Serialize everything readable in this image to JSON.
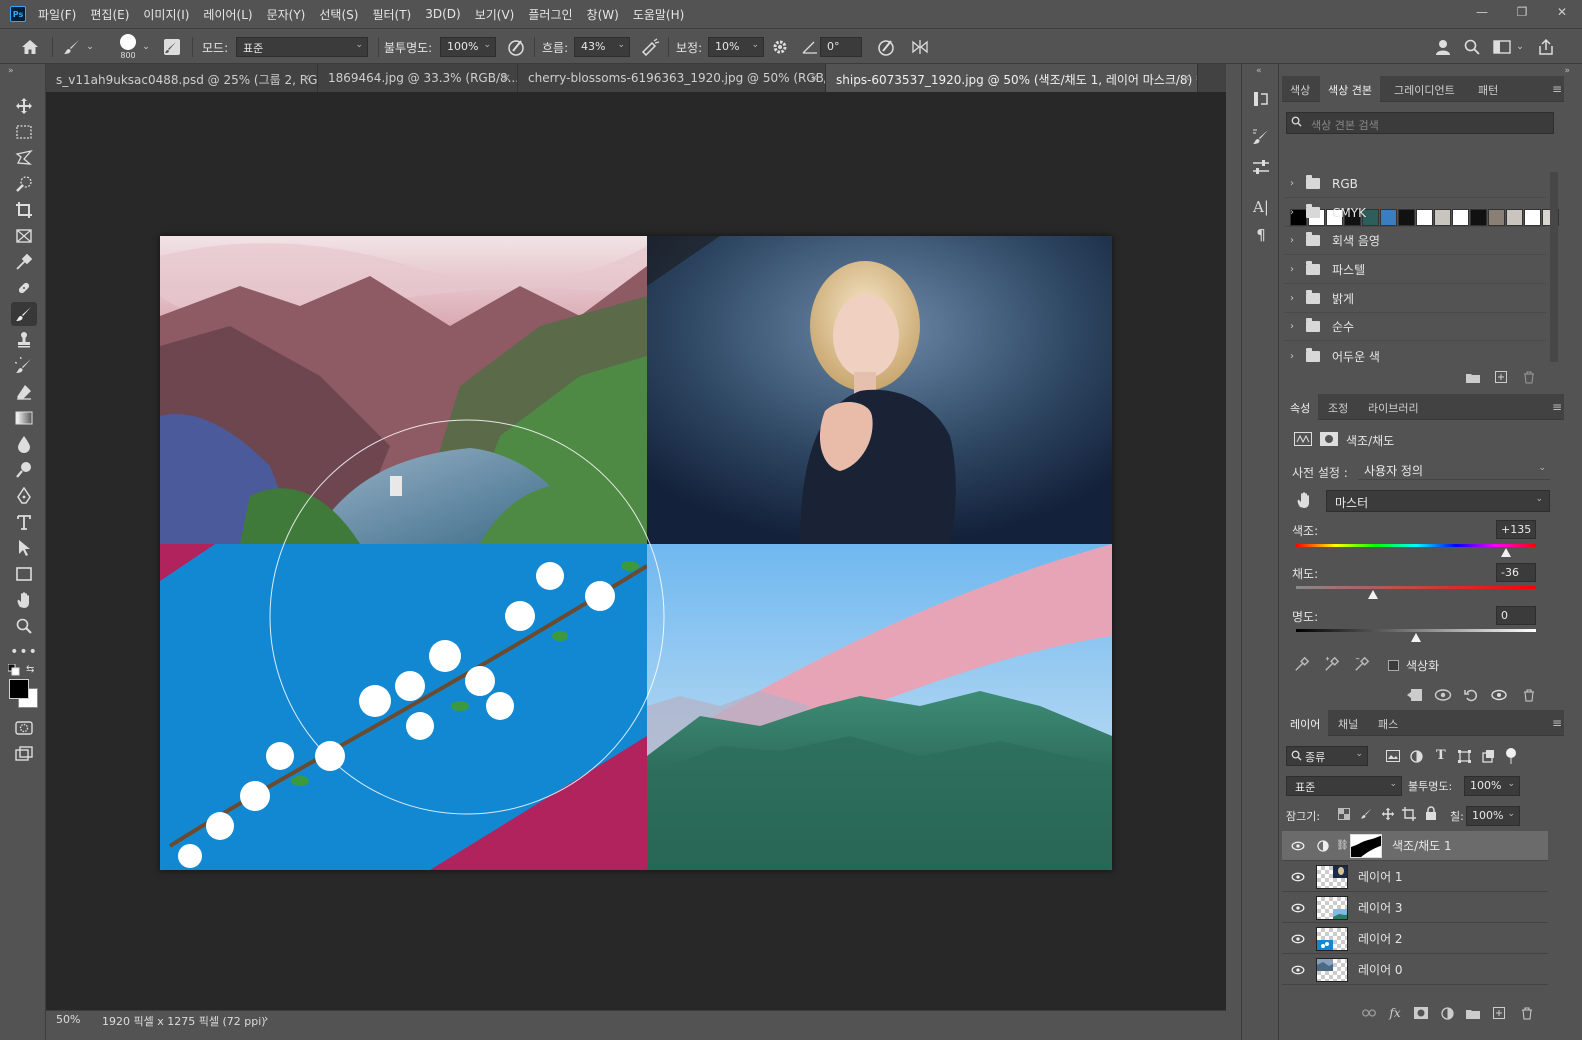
{
  "app": {
    "logo": "Ps"
  },
  "menu": [
    "파일(F)",
    "편집(E)",
    "이미지(I)",
    "레이어(L)",
    "문자(Y)",
    "선택(S)",
    "필터(T)",
    "3D(D)",
    "보기(V)",
    "플러그인",
    "창(W)",
    "도움말(H)"
  ],
  "window_controls": {
    "minimize": "—",
    "restore": "❐",
    "close": "✕"
  },
  "options": {
    "brush_size": "800",
    "mode_label": "모드:",
    "mode_value": "표준",
    "opacity_label": "불투명도:",
    "opacity_value": "100%",
    "flow_label": "흐름:",
    "flow_value": "43%",
    "smoothing_label": "보정:",
    "smoothing_value": "10%",
    "angle_value": "0°"
  },
  "tabs": [
    {
      "label": "s_v11ah9uksac0488.psd @ 25% (그룹 2, RG...",
      "close": "×"
    },
    {
      "label": "1869464.jpg @ 33.3% (RGB/8...",
      "close": "×"
    },
    {
      "label": "cherry-blossoms-6196363_1920.jpg @ 50% (RGB/...",
      "close": "×"
    },
    {
      "label": "ships-6073537_1920.jpg @ 50% (색조/채도 1, 레이어 마스크/8) *",
      "close": "×"
    }
  ],
  "status": {
    "zoom": "50%",
    "doc_size": "1920 픽셀 x 1275 픽셀 (72 ppi)",
    "arrow": "›"
  },
  "swatches_panel": {
    "tabs": [
      "색상",
      "색상 견본",
      "그레이디언트",
      "패턴"
    ],
    "search_placeholder": "색상 견본 검색",
    "colors": [
      "#000000",
      "#ffffff",
      "#ffffff",
      "#111111",
      "#2c5f5c",
      "#3a7dc0",
      "#111111",
      "#ffffff",
      "#c9c4bd",
      "#ffffff",
      "#111111",
      "#8a7f74",
      "#c9c4bd",
      "#ffffff",
      "#d9d5d0"
    ],
    "groups": [
      "RGB",
      "CMYK",
      "회색 음영",
      "파스텔",
      "밝게",
      "순수",
      "어두운 색"
    ]
  },
  "properties_panel": {
    "tabs": [
      "속성",
      "조정",
      "라이브러리"
    ],
    "title": "색조/채도",
    "preset_label": "사전 설정 :",
    "preset_value": "사용자 정의",
    "channel_value": "마스터",
    "hue_label": "색조:",
    "hue_value": "+135",
    "hue": 135,
    "saturation_label": "채도:",
    "saturation_value": "-36",
    "saturation": -36,
    "lightness_label": "명도:",
    "lightness_value": "0",
    "lightness": 0,
    "colorize_label": "색상화"
  },
  "layers_panel": {
    "tabs": [
      "레이어",
      "채널",
      "패스"
    ],
    "filter_value": "종류",
    "blend_value": "표준",
    "opacity_label": "불투명도:",
    "opacity_value": "100%",
    "lock_label": "잠그기:",
    "fill_label": "칠:",
    "fill_value": "100%",
    "layers": [
      {
        "name": "색조/채도 1",
        "type": "adjustment"
      },
      {
        "name": "레이어 1",
        "type": "portrait"
      },
      {
        "name": "레이어 3",
        "type": "mountain"
      },
      {
        "name": "레이어 2",
        "type": "blossom"
      },
      {
        "name": "레이어 0",
        "type": "fjord"
      }
    ]
  }
}
